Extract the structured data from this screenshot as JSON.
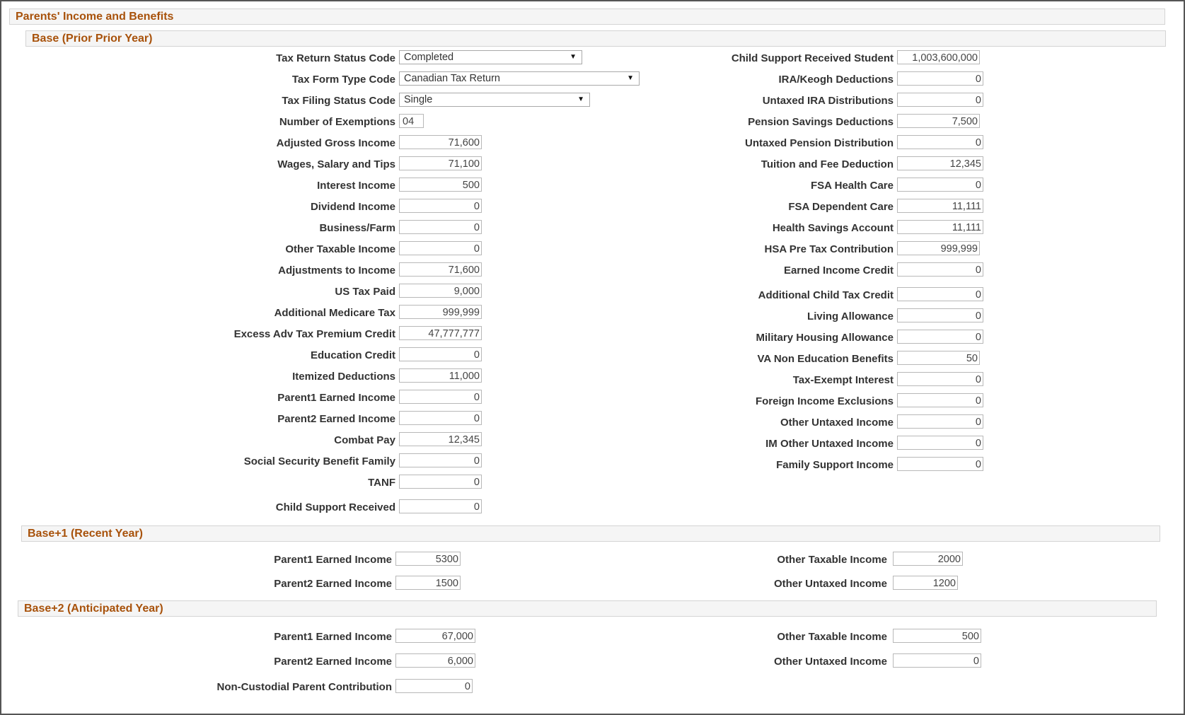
{
  "page_title": "Parents' Income and Benefits",
  "base": {
    "heading": "Base (Prior Prior Year)",
    "tax_return_status": {
      "label": "Tax Return Status Code",
      "value": "Completed"
    },
    "tax_form_type": {
      "label": "Tax Form Type Code",
      "value": "Canadian Tax Return"
    },
    "tax_filing_status": {
      "label": "Tax Filing Status Code",
      "value": "Single"
    },
    "exemptions": {
      "label": "Number of Exemptions",
      "value": "04"
    },
    "left_fields": [
      {
        "label": "Adjusted Gross Income",
        "value": "71,600"
      },
      {
        "label": "Wages, Salary and Tips",
        "value": "71,100"
      },
      {
        "label": "Interest Income",
        "value": "500"
      },
      {
        "label": "Dividend Income",
        "value": "0"
      },
      {
        "label": "Business/Farm",
        "value": "0"
      },
      {
        "label": "Other Taxable Income",
        "value": "0"
      },
      {
        "label": "Adjustments to Income",
        "value": "71,600"
      },
      {
        "label": "US Tax Paid",
        "value": "9,000"
      },
      {
        "label": "Additional Medicare Tax",
        "value": "999,999"
      },
      {
        "label": "Excess Adv Tax Premium Credit",
        "value": "47,777,777"
      },
      {
        "label": "Education Credit",
        "value": "0"
      },
      {
        "label": "Itemized Deductions",
        "value": "11,000"
      },
      {
        "label": "Parent1 Earned Income",
        "value": "0"
      },
      {
        "label": "Parent2 Earned Income",
        "value": "0"
      },
      {
        "label": "Combat Pay",
        "value": "12,345"
      },
      {
        "label": "Social Security Benefit Family",
        "value": "0"
      },
      {
        "label": "TANF",
        "value": "0"
      },
      {
        "label": "Child Support Received",
        "value": "0"
      }
    ],
    "right_fields": [
      {
        "label": "Child Support Received Student",
        "value": "1,003,600,000"
      },
      {
        "label": "IRA/Keogh Deductions",
        "value": "0"
      },
      {
        "label": "Untaxed IRA Distributions",
        "value": "0"
      },
      {
        "label": "Pension Savings Deductions",
        "value": "7,500"
      },
      {
        "label": "Untaxed Pension Distribution",
        "value": "0"
      },
      {
        "label": "Tuition and Fee Deduction",
        "value": "12,345"
      },
      {
        "label": "FSA Health Care",
        "value": "0"
      },
      {
        "label": "FSA Dependent Care",
        "value": "11,111"
      },
      {
        "label": "Health Savings Account",
        "value": "11,111"
      },
      {
        "label": "HSA Pre Tax Contribution",
        "value": "999,999"
      },
      {
        "label": "Earned Income Credit",
        "value": "0"
      },
      {
        "label": "Additional Child Tax Credit",
        "value": "0"
      },
      {
        "label": "Living Allowance",
        "value": "0"
      },
      {
        "label": "Military Housing Allowance",
        "value": "0"
      },
      {
        "label": "VA Non Education Benefits",
        "value": "50"
      },
      {
        "label": "Tax-Exempt Interest",
        "value": "0"
      },
      {
        "label": "Foreign Income Exclusions",
        "value": "0"
      },
      {
        "label": "Other Untaxed Income",
        "value": "0"
      },
      {
        "label": "IM Other Untaxed Income",
        "value": "0"
      },
      {
        "label": "Family Support Income",
        "value": "0"
      }
    ]
  },
  "base1": {
    "heading": "Base+1 (Recent Year)",
    "parent1": {
      "label": "Parent1 Earned Income",
      "value": "5300"
    },
    "parent2": {
      "label": "Parent2 Earned Income",
      "value": "1500"
    },
    "other_taxable": {
      "label": "Other Taxable Income",
      "value": "2000"
    },
    "other_untaxed": {
      "label": "Other Untaxed Income",
      "value": "1200"
    }
  },
  "base2": {
    "heading": "Base+2 (Anticipated Year)",
    "parent1": {
      "label": "Parent1 Earned Income",
      "value": "67,000"
    },
    "parent2": {
      "label": "Parent2 Earned Income",
      "value": "6,000"
    },
    "noncustodial": {
      "label": "Non-Custodial Parent Contribution",
      "value": "0"
    },
    "other_taxable": {
      "label": "Other Taxable Income",
      "value": "500"
    },
    "other_untaxed": {
      "label": "Other Untaxed Income",
      "value": "0"
    }
  }
}
